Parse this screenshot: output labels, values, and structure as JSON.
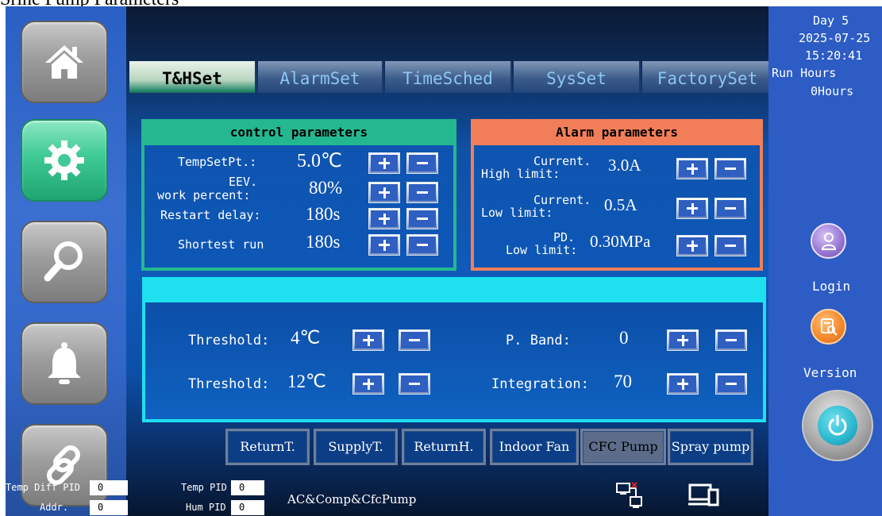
{
  "caption": "Srine Pump Parameters",
  "nav": [
    "home-icon",
    "gear-icon",
    "search-icon",
    "bell-icon",
    "link-icon"
  ],
  "tabs": [
    "T&HSet",
    "AlarmSet",
    "TimeSched",
    "SysSet",
    "FactorySet"
  ],
  "control": {
    "title": "control parameters",
    "rows": [
      {
        "label": "TempSetPt.:",
        "value": "5.0℃"
      },
      {
        "label1": "EEV.",
        "label2": "work percent:",
        "value": "80%"
      },
      {
        "label": "Restart delay:",
        "value": "180s"
      },
      {
        "label": "Shortest run",
        "value": "180s"
      }
    ]
  },
  "alarm": {
    "title": "Alarm parameters",
    "rows": [
      {
        "label1": "Current.",
        "label2": "High limit:",
        "value": "3.0A"
      },
      {
        "label1": "Current.",
        "label2": "Low limit:",
        "value": "0.5A"
      },
      {
        "label1": "PD.",
        "label2": "Low limit:",
        "value": "0.30MPa"
      }
    ]
  },
  "pid": {
    "threshold1_label": "Threshold:",
    "threshold1_value": "4℃",
    "threshold2_label": "Threshold:",
    "threshold2_value": "12℃",
    "pband_label": "P. Band:",
    "pband_value": "0",
    "integration_label": "Integration:",
    "integration_value": "70"
  },
  "right": {
    "day": "Day  5",
    "date": "2025-07-25",
    "time": "15:20:41",
    "run_hours_label": "Run Hours",
    "run_hours_value": "0Hours",
    "login": "Login",
    "version": "Version"
  },
  "bottom_buttons": [
    "ReturnT.",
    "SupplyT.",
    "ReturnH.",
    "Indoor Fan",
    "CFC Pump",
    "Spray pump"
  ],
  "selected_bottom": "CFC Pump",
  "status": {
    "temp_diff_pid_label": "Temp Diff PID",
    "temp_diff_pid_value": "0",
    "temp_pid_label": "Temp PID",
    "temp_pid_value": "0",
    "addr_label": "Addr.",
    "addr_value": "0",
    "hum_pid_label": "Hum PID",
    "hum_pid_value": "0",
    "mode": "AC&Comp&CfcPump"
  },
  "colors": {
    "control_header": "#24b890",
    "alarm_header": "#f27e59",
    "pid_border": "#1ee0ee",
    "active_nav": "#3fc994"
  }
}
